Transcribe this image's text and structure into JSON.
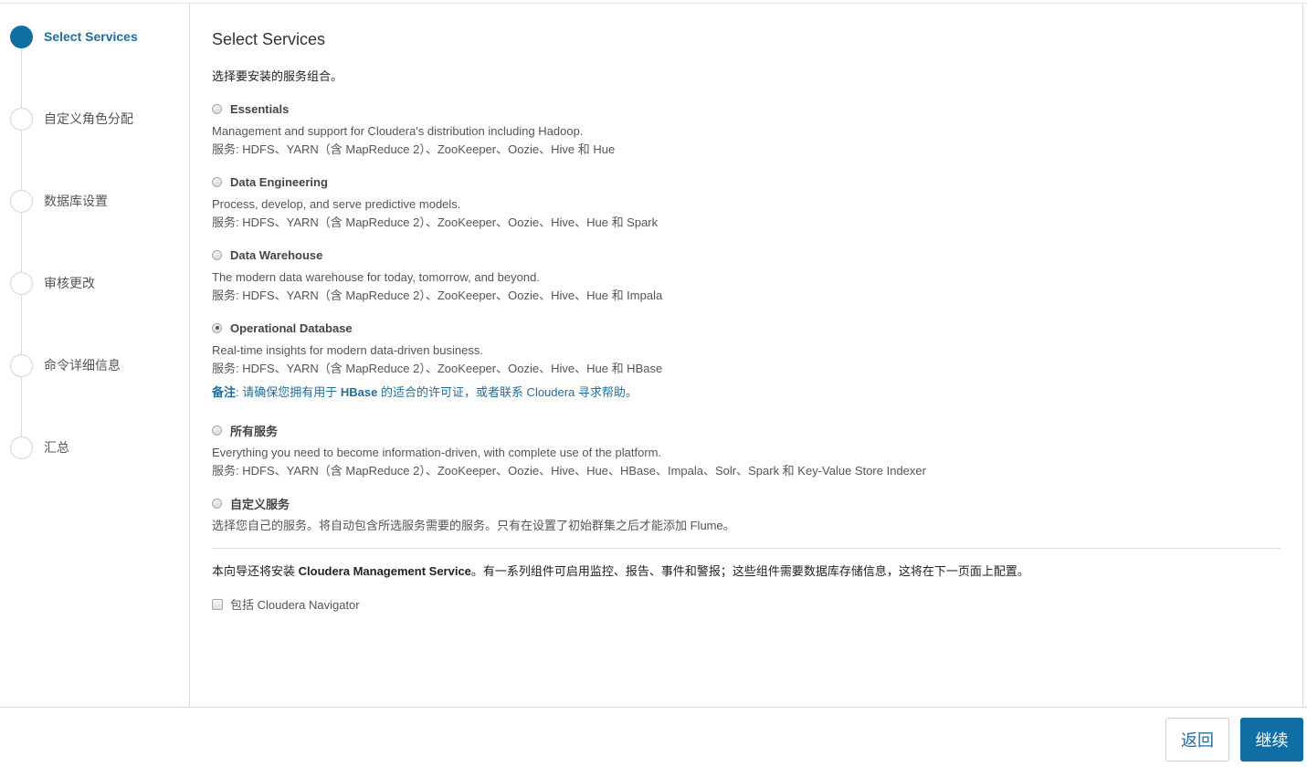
{
  "steps": [
    {
      "label": "Select Services",
      "active": true
    },
    {
      "label": "自定义角色分配",
      "active": false
    },
    {
      "label": "数据库设置",
      "active": false
    },
    {
      "label": "审核更改",
      "active": false
    },
    {
      "label": "命令详细信息",
      "active": false
    },
    {
      "label": "汇总",
      "active": false
    }
  ],
  "main": {
    "title": "Select Services",
    "subtitle": "选择要安装的服务组合。",
    "options": [
      {
        "title": "Essentials",
        "desc": "Management and support for Cloudera's distribution including Hadoop.",
        "services": "服务: HDFS、YARN（含 MapReduce 2）、ZooKeeper、Oozie、Hive 和 Hue",
        "checked": false
      },
      {
        "title": "Data Engineering",
        "desc": "Process, develop, and serve predictive models.",
        "services": "服务: HDFS、YARN（含 MapReduce 2）、ZooKeeper、Oozie、Hive、Hue 和 Spark",
        "checked": false
      },
      {
        "title": "Data Warehouse",
        "desc": "The modern data warehouse for today, tomorrow, and beyond.",
        "services": "服务: HDFS、YARN（含 MapReduce 2）、ZooKeeper、Oozie、Hive、Hue 和 Impala",
        "checked": false
      },
      {
        "title": "Operational Database",
        "desc": "Real-time insights for modern data-driven business.",
        "services": "服务: HDFS、YARN（含 MapReduce 2）、ZooKeeper、Oozie、Hive、Hue 和 HBase",
        "checked": true,
        "note_label": "备注",
        "note_pre": ": 请确保您拥有用于 ",
        "note_bold": "HBase",
        "note_post": " 的适合的许可证，或者联系 Cloudera 寻求帮助。"
      },
      {
        "title": "所有服务",
        "desc": "Everything you need to become information-driven, with complete use of the platform.",
        "services": "服务: HDFS、YARN（含 MapReduce 2）、ZooKeeper、Oozie、Hive、Hue、HBase、Impala、Solr、Spark 和 Key-Value Store Indexer",
        "checked": false
      },
      {
        "title": "自定义服务",
        "desc": "选择您自己的服务。将自动包含所选服务需要的服务。只有在设置了初始群集之后才能添加 Flume。",
        "checked": false
      }
    ],
    "mgmt_pre": "本向导还将安装 ",
    "mgmt_bold": "Cloudera Management Service",
    "mgmt_post": "。有一系列组件可启用监控、报告、事件和警报；这些组件需要数据库存储信息，这将在下一页面上配置。",
    "navigator_label": "包括 Cloudera Navigator"
  },
  "footer": {
    "back_label": "返回",
    "continue_label": "继续"
  },
  "colors": {
    "accent": "#0f6fa5",
    "link": "#1f6e9c"
  }
}
